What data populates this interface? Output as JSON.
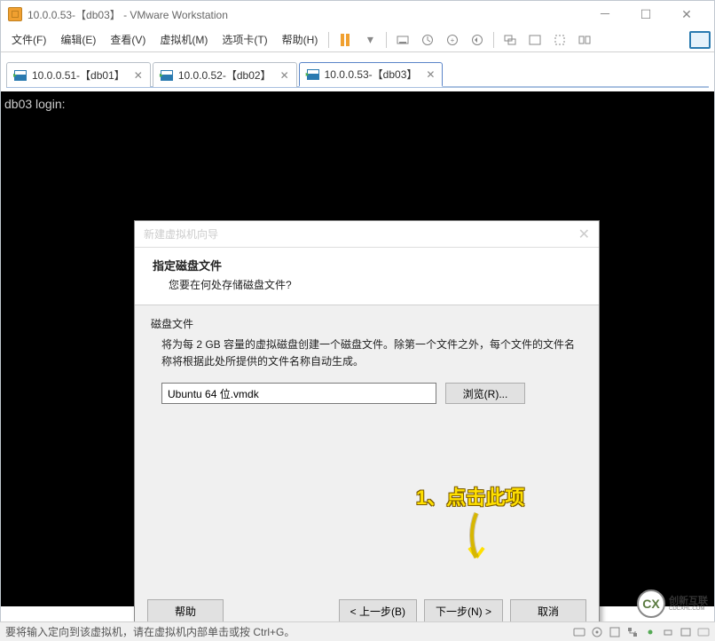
{
  "titlebar": {
    "title": "10.0.0.53-【db03】  - VMware Workstation"
  },
  "menu": {
    "file": "文件(F)",
    "edit": "编辑(E)",
    "view": "查看(V)",
    "vm": "虚拟机(M)",
    "tabs": "选项卡(T)",
    "help": "帮助(H)"
  },
  "tabs": [
    {
      "label": "10.0.0.51-【db01】",
      "active": false
    },
    {
      "label": "10.0.0.52-【db02】",
      "active": false
    },
    {
      "label": "10.0.0.53-【db03】",
      "active": true
    }
  ],
  "terminal": {
    "line1": "db03 login:"
  },
  "dialog": {
    "wizard_title": "新建虚拟机向导",
    "heading": "指定磁盘文件",
    "subheading": "您要在何处存储磁盘文件?",
    "section_label": "磁盘文件",
    "section_desc": "将为每 2 GB 容量的虚拟磁盘创建一个磁盘文件。除第一个文件之外，每个文件的文件名称将根据此处所提供的文件名称自动生成。",
    "file_value": "Ubuntu 64 位.vmdk",
    "browse": "浏览(R)...",
    "help": "帮助",
    "back": "< 上一步(B)",
    "next": "下一步(N) >",
    "cancel": "取消"
  },
  "annotation": {
    "text": "1、点击此项"
  },
  "statusbar": {
    "text": "要将输入定向到该虚拟机，请在虚拟机内部单击或按 Ctrl+G。"
  },
  "watermark": {
    "logo": "CX",
    "text": "创新互联",
    "sub": "CDCXHL.COM"
  }
}
